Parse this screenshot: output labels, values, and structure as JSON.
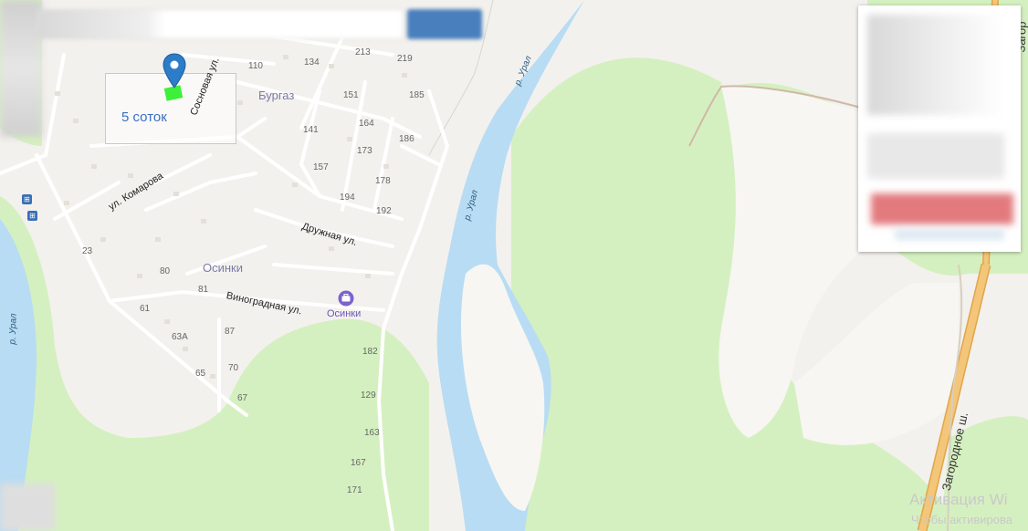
{
  "map": {
    "plot_label": "5 соток",
    "settlements": [
      {
        "name": "Бургаз"
      },
      {
        "name": "Осинки"
      }
    ],
    "streets": [
      "Сосновая ул.",
      "ул. Комарова",
      "Дружная ул.",
      "Виноградная ул."
    ],
    "rivers": [
      "р. Урал",
      "р. Урал",
      "р. Урал"
    ],
    "highway": "Загородное ш.",
    "highway_top": "Загор",
    "poi": {
      "name": "Осинки",
      "icon": "briefcase-icon"
    },
    "house_numbers": [
      "213",
      "219",
      "110",
      "134",
      "151",
      "185",
      "164",
      "141",
      "186",
      "173",
      "157",
      "178",
      "194",
      "192",
      "23",
      "80",
      "81",
      "61",
      "87",
      "63А",
      "65",
      "70",
      "67",
      "182",
      "129",
      "163",
      "167",
      "171"
    ],
    "colors": {
      "water": "#b8dcf3",
      "forest": "#d5f0c0",
      "land": "#f3f1ed",
      "highway": "#f3c679",
      "pin": "#2c7cc8",
      "plot_marker": "#3ef03a"
    }
  },
  "watermark": {
    "line1": "Активация Wi",
    "line2": "Чтобы активирова"
  }
}
